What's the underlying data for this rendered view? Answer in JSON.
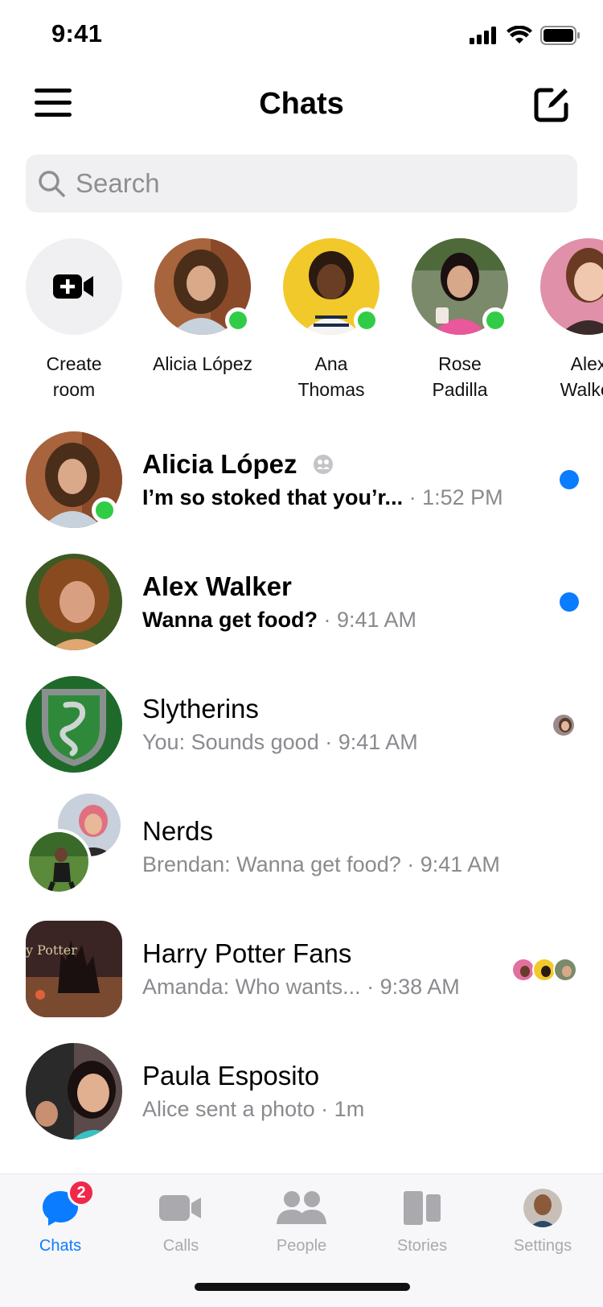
{
  "status_bar": {
    "time": "9:41"
  },
  "header": {
    "title": "Chats"
  },
  "search": {
    "placeholder": "Search"
  },
  "stories": [
    {
      "line1": "Create",
      "line2": "room",
      "type": "create"
    },
    {
      "line1": "Alicia López",
      "line2": "",
      "online": true,
      "color": "#b88a6a"
    },
    {
      "line1": "Ana",
      "line2": "Thomas",
      "online": true,
      "color": "#f2c92a"
    },
    {
      "line1": "Rose",
      "line2": "Padilla",
      "online": true,
      "color": "#7a8a6a"
    },
    {
      "line1": "Alex",
      "line2": "Walker",
      "online": false,
      "color": "#e090a8"
    }
  ],
  "chats": [
    {
      "name": "Alicia López",
      "message": "I’m so stoked that you’r...",
      "time": "1:52 PM",
      "unread": true,
      "online": true,
      "muted_icon": "group-icon",
      "color": "#b88a6a"
    },
    {
      "name": "Alex Walker",
      "message": "Wanna get food?",
      "time": "9:41 AM",
      "unread": true,
      "online": false,
      "color": "#a86a3a"
    },
    {
      "name": "Slytherins",
      "message": "You: Sounds good",
      "time": "9:41 AM",
      "unread": false,
      "online": false,
      "color": "#2c7a3a"
    },
    {
      "name": "Nerds",
      "message": "Brendan: Wanna get food?",
      "time": "9:41 AM",
      "unread": false,
      "online": false,
      "color": "#4a7a4a"
    },
    {
      "name": "Harry Potter Fans",
      "message": "Amanda: Who wants...",
      "time": "9:38 AM",
      "unread": false,
      "online": false,
      "color": "#4a3030"
    },
    {
      "name": "Paula Esposito",
      "message": "Alice sent a photo",
      "time": "1m",
      "unread": false,
      "online": false,
      "color": "#5a4a4a"
    }
  ],
  "tabs": [
    {
      "label": "Chats",
      "active": true,
      "badge": "2",
      "icon": "chat-bubble-icon"
    },
    {
      "label": "Calls",
      "active": false,
      "icon": "video-camera-icon"
    },
    {
      "label": "People",
      "active": false,
      "icon": "people-icon"
    },
    {
      "label": "Stories",
      "active": false,
      "icon": "stories-icon"
    },
    {
      "label": "Settings",
      "active": false,
      "icon": "profile-avatar-icon"
    }
  ],
  "colors": {
    "accent": "#0a7cff",
    "online": "#31cc46",
    "badge": "#f02849"
  }
}
